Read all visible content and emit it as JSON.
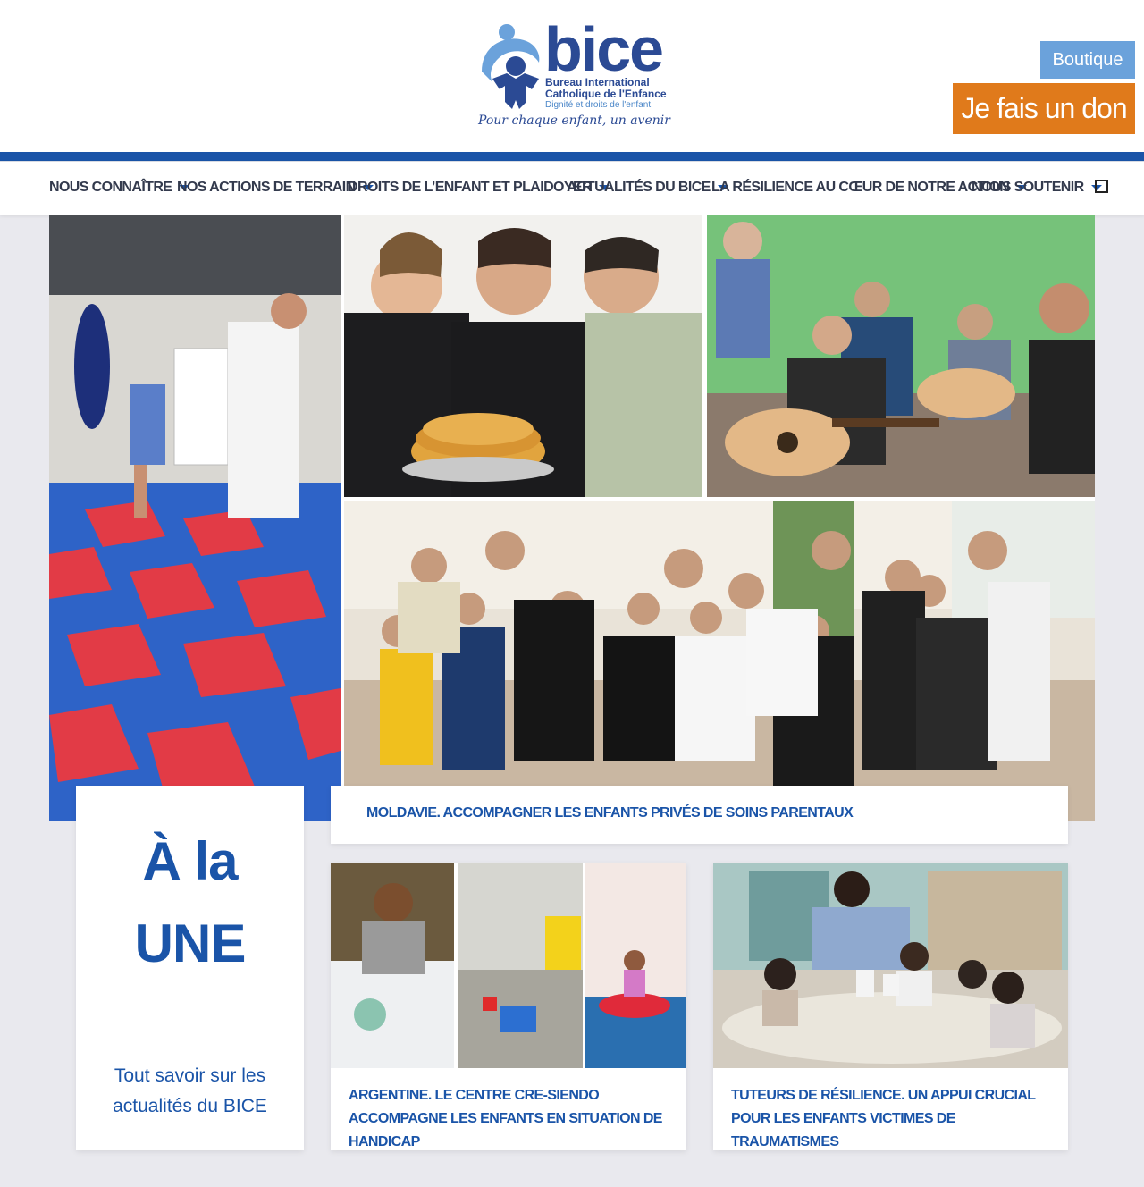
{
  "header": {
    "logo": {
      "word": "bice",
      "line1": "Bureau International",
      "line2": "Catholique de l'Enfance",
      "line3": "Dignité et droits de l'enfant",
      "tagline": "Pour chaque enfant, un avenir"
    },
    "boutique_label": "Boutique",
    "donate_label": "Je fais un don"
  },
  "nav": {
    "items": [
      {
        "label": "Nous connaître"
      },
      {
        "label": "Nos actions de terrain"
      },
      {
        "label": "Droits de l’enfant et plaidoyer"
      },
      {
        "label": "Actualités du BICE"
      },
      {
        "label": "La résilience au cœur de notre action"
      },
      {
        "label": "Nous soutenir"
      }
    ],
    "search_icon": "search-icon"
  },
  "hero": {
    "title": "Moldavie. Accompagner les enfants privés de soins parentaux"
  },
  "une": {
    "line1": "À la",
    "line2": "UNE",
    "subtitle": "Tout savoir sur les actualités du BICE"
  },
  "news": [
    {
      "title": "Argentine. Le centre CRE-Siendo accompagne les enfants en situation de handicap"
    },
    {
      "title": "Tuteurs de résilience. Un appui crucial pour les enfants victimes de traumatismes"
    }
  ],
  "colors": {
    "brand_blue": "#1a54a8",
    "boutique_bg": "#6ba2db",
    "donate_bg": "#e07a1b",
    "page_bg": "#e9e9ee"
  }
}
